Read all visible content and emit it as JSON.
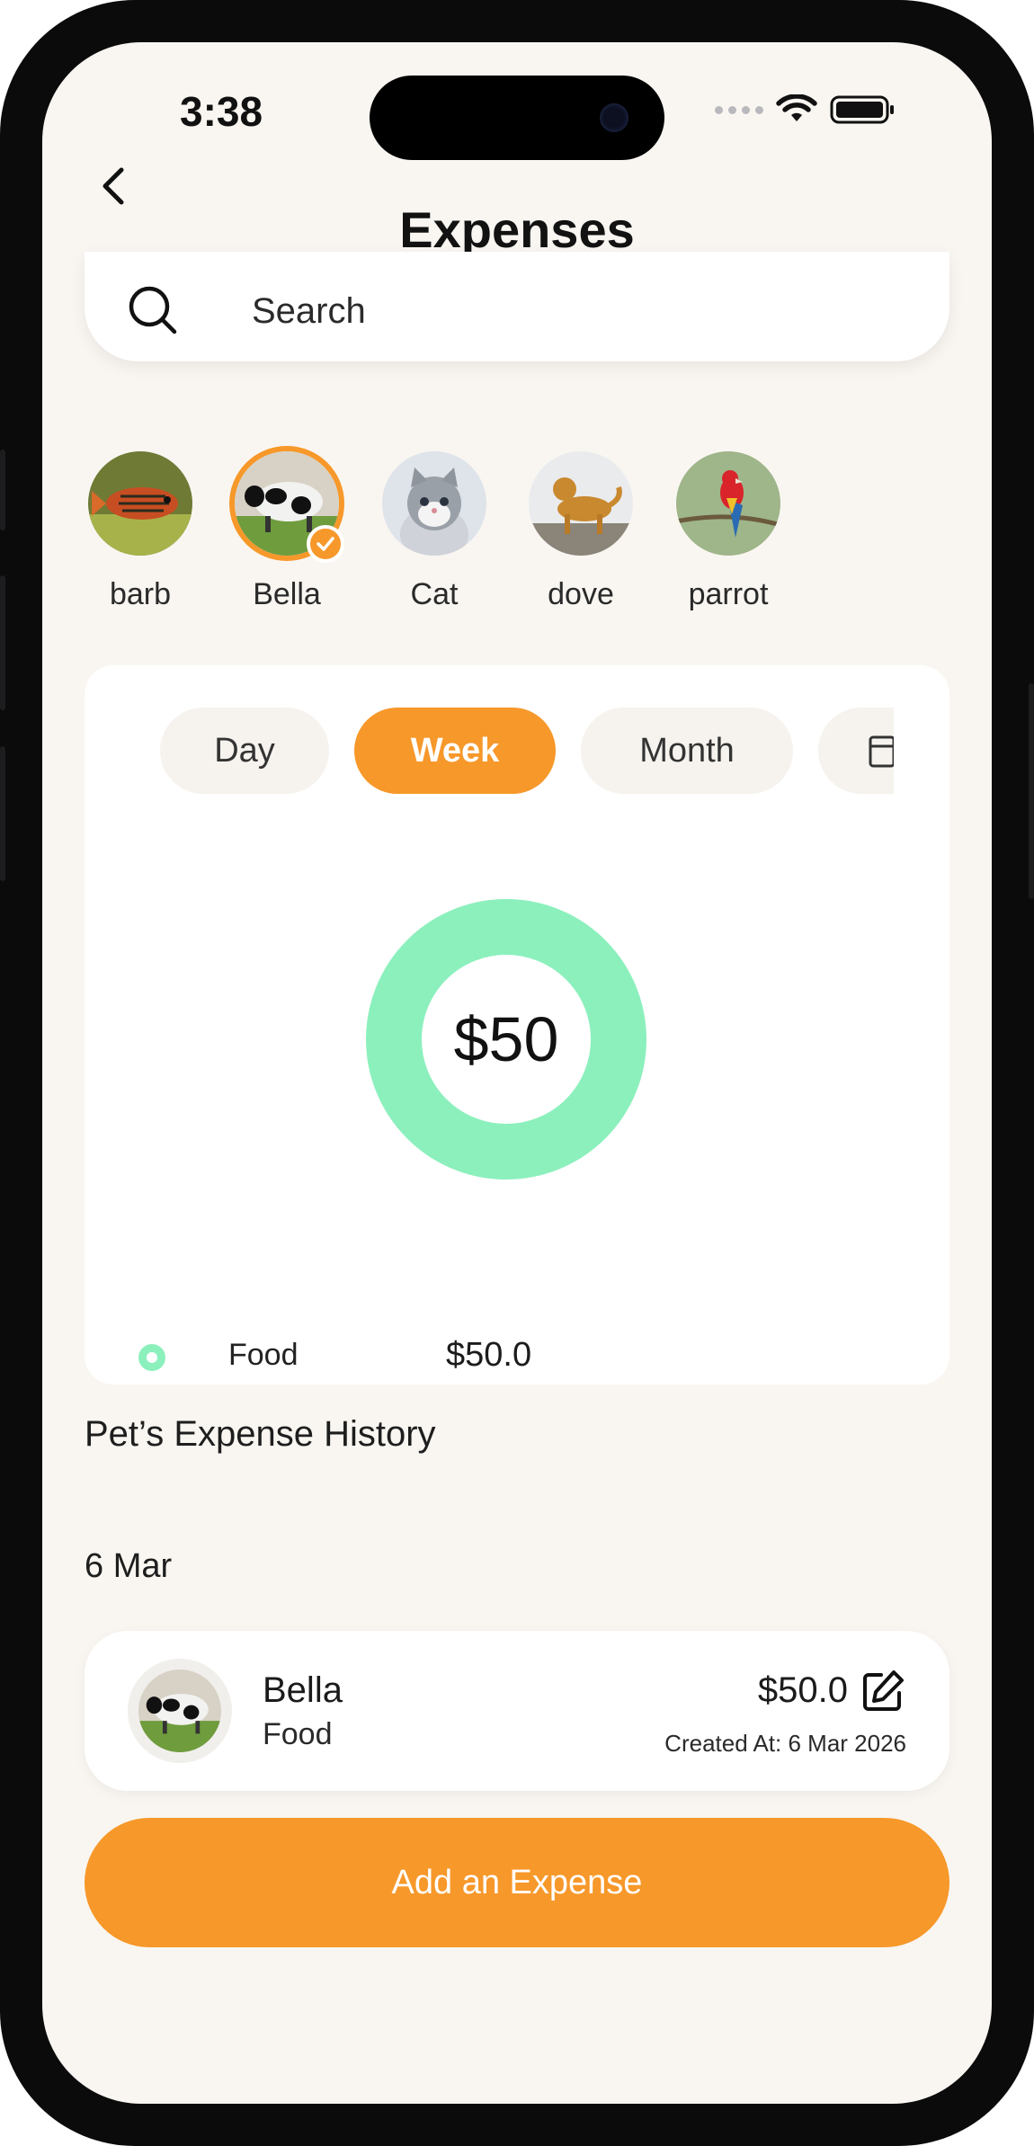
{
  "status_bar": {
    "time": "3:38"
  },
  "header": {
    "title": "Expenses"
  },
  "search": {
    "placeholder": "Search"
  },
  "pets": [
    {
      "name": "barb",
      "selected": false
    },
    {
      "name": "Bella",
      "selected": true
    },
    {
      "name": "Cat",
      "selected": false
    },
    {
      "name": "dove",
      "selected": false
    },
    {
      "name": "parrot",
      "selected": false
    }
  ],
  "period_tabs": [
    {
      "label": "Day",
      "active": false
    },
    {
      "label": "Week",
      "active": true
    },
    {
      "label": "Month",
      "active": false
    }
  ],
  "summary": {
    "total": "$50",
    "legend": [
      {
        "name": "Food",
        "value": "$50.0",
        "color": "#8cf0bd"
      }
    ]
  },
  "chart_data": {
    "type": "pie",
    "categories": [
      "Food"
    ],
    "values": [
      50
    ],
    "title": "",
    "center_label": "$50"
  },
  "history": {
    "title": "Pet’s Expense History",
    "groups": [
      {
        "date": "6 Mar",
        "items": [
          {
            "pet": "Bella",
            "category": "Food",
            "amount": "$50.0",
            "created": "Created At: 6 Mar 2026"
          }
        ]
      }
    ]
  },
  "actions": {
    "add_expense": "Add an Expense"
  },
  "colors": {
    "accent": "#f7982a",
    "food": "#8cf0bd",
    "background": "#f9f6f1"
  }
}
